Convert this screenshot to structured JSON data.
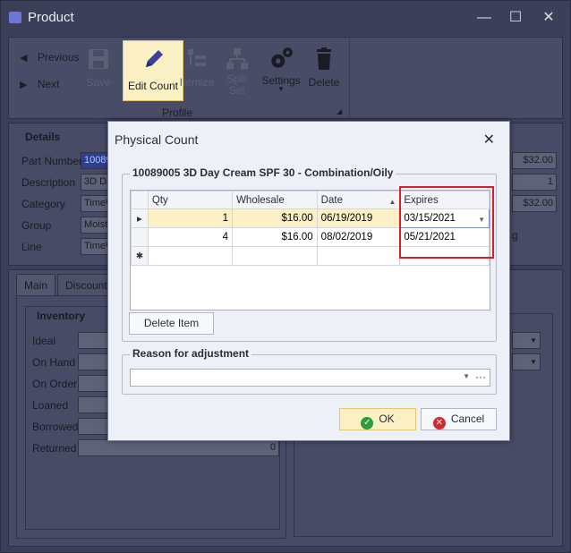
{
  "window": {
    "title": "Product",
    "controls": {
      "minimize": "—",
      "maximize": "☐",
      "close": "✕"
    }
  },
  "ribbon": {
    "nav": {
      "previous": "Previous",
      "next": "Next"
    },
    "buttons": {
      "save": "Save",
      "edit_count": "Edit Count",
      "itemize": "Itemize",
      "split_set_line1": "Split",
      "split_set_line2": "Set",
      "settings": "Settings",
      "delete": "Delete"
    },
    "group_label": "Profile"
  },
  "details": {
    "header": "Details",
    "labels": {
      "part_number": "Part Number",
      "description": "Description",
      "category": "Category",
      "group": "Group",
      "line": "Line"
    },
    "values": {
      "part_number": "10089",
      "description": "3D Da",
      "category": "TimeW",
      "group": "Moistu",
      "line": "TimeW"
    },
    "right_values": {
      "price1": "$32.00",
      "qty": "1",
      "price2": "$32.00"
    },
    "partial_label": "g"
  },
  "tabs": {
    "items": [
      "Main",
      "Discounts"
    ],
    "inventory_header": "Inventory",
    "inventory_labels": [
      "Ideal",
      "On Hand",
      "On Order",
      "Loaned",
      "Borrowed",
      "Returned"
    ],
    "returned_value": "0"
  },
  "dialog": {
    "title": "Physical Count",
    "close": "✕",
    "group_title": "10089005 3D Day Cream SPF 30 - Combination/Oily",
    "columns": [
      "Qty",
      "Wholesale",
      "Date",
      "Expires"
    ],
    "rows": [
      {
        "qty": "1",
        "wholesale": "$16.00",
        "date": "06/19/2019",
        "expires": "03/15/2021"
      },
      {
        "qty": "4",
        "wholesale": "$16.00",
        "date": "08/02/2019",
        "expires": "05/21/2021"
      }
    ],
    "row_indicators": {
      "current": "▸",
      "new": "✱"
    },
    "delete_item": "Delete Item",
    "reason_title": "Reason for adjustment",
    "reason_value": "",
    "reason_ellipsis": "···",
    "ok": "OK",
    "cancel": "Cancel"
  },
  "colors": {
    "dim_background": "#3b3f5a",
    "dialog_bg": "#eef0f7",
    "highlight_row": "#fcf1c6",
    "accent_box": "#d62027",
    "ok_icon": "#2e9b3e",
    "cancel_icon": "#d12b2b"
  }
}
